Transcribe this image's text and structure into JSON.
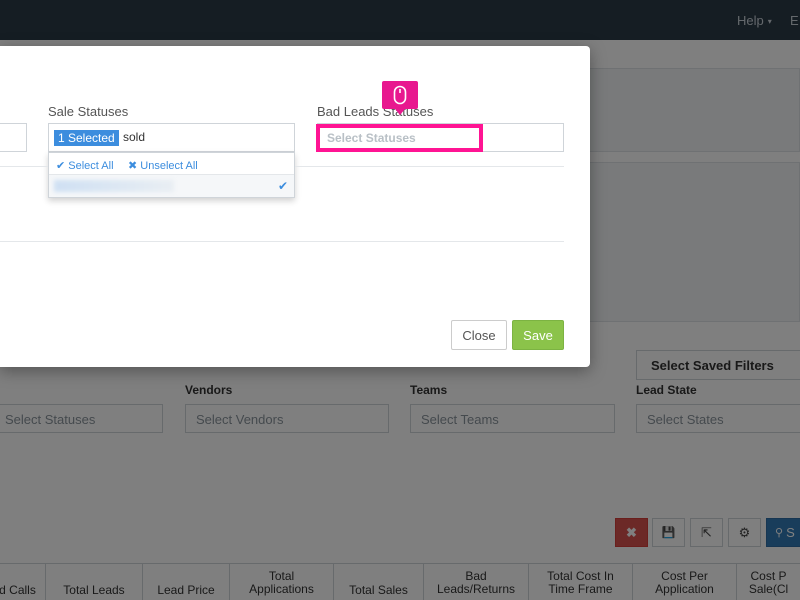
{
  "topnav": {
    "help_label": "Help",
    "help_caret": "▾",
    "user_initial": "E"
  },
  "filters": {
    "saved_filters_label": "Select Saved Filters",
    "statuses_placeholder": "Select Statuses",
    "vendors_label": "Vendors",
    "vendors_placeholder": "Select Vendors",
    "teams_label": "Teams",
    "teams_placeholder": "Select Teams",
    "lead_state_label": "Lead State",
    "lead_state_placeholder": "Select States"
  },
  "toolbar": {
    "clear_icon": "✖",
    "save_icon": "💾",
    "export_icon": "⇱",
    "settings_icon": "⚙",
    "search_label": "S"
  },
  "table": {
    "headers": [
      {
        "line1": "d Calls",
        "line2": ""
      },
      {
        "line1": "Total Leads",
        "line2": ""
      },
      {
        "line1": "Lead Price",
        "line2": ""
      },
      {
        "line1": "Total",
        "line2": "Applications"
      },
      {
        "line1": "Total Sales",
        "line2": ""
      },
      {
        "line1": "Bad",
        "line2": "Leads/Returns"
      },
      {
        "line1": "Total Cost In",
        "line2": "Time Frame"
      },
      {
        "line1": "Cost Per",
        "line2": "Application"
      },
      {
        "line1": "Cost P",
        "line2": "Sale(Cl"
      }
    ]
  },
  "modal": {
    "sale_statuses_label": "Sale Statuses",
    "selected_tag": "1 Selected",
    "search_value": "sold",
    "select_all": "Select All",
    "unselect_all": "Unselect All",
    "check_glyph": "✔",
    "cross_glyph": "✖",
    "bad_leads_label": "Bad Leads Statuses",
    "bad_leads_placeholder": "Select Statuses",
    "close_label": "Close",
    "save_label": "Save"
  },
  "colors": {
    "nav_bg": "#2b3a47",
    "accent_blue": "#3c8dde",
    "save_green": "#8bc34a",
    "highlight_pink": "#ff1493",
    "danger_red": "#d9534f"
  }
}
